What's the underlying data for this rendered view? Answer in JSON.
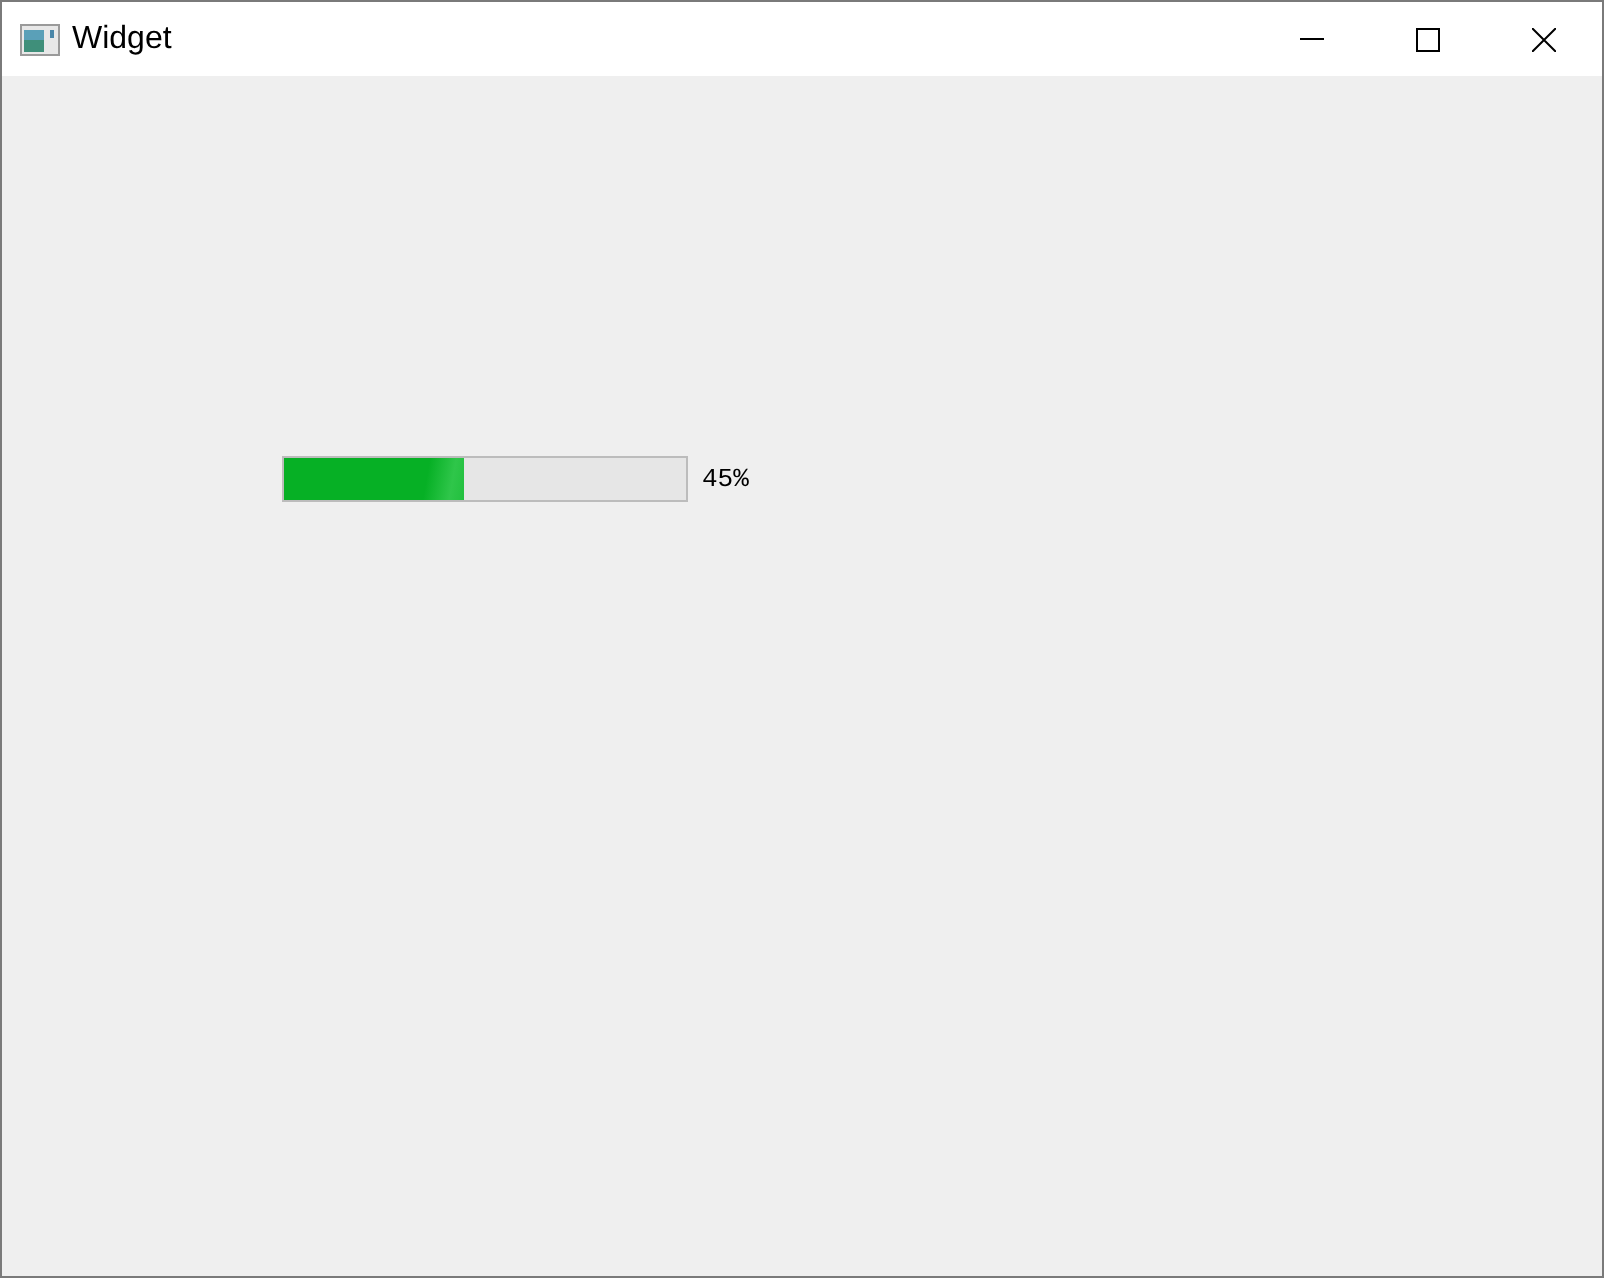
{
  "window": {
    "title": "Widget"
  },
  "progress_bar": {
    "level": 0.45,
    "reading": "45%"
  }
}
